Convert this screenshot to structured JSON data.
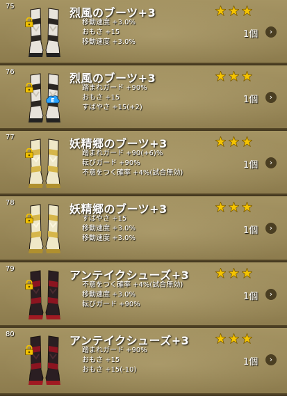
{
  "items": [
    {
      "number": "75",
      "name": "烈風のブーツ+3",
      "stats": [
        "移動速度 +3.0%",
        "おもさ +15",
        "移動速度 +3.0%"
      ],
      "quantity": "1個",
      "boot_style": "white-black",
      "equipped": false
    },
    {
      "number": "76",
      "name": "烈風のブーツ+3",
      "stats": [
        "踏まれガード +90%",
        "おもさ +15",
        "すばやさ +15(+2)"
      ],
      "quantity": "1個",
      "boot_style": "white-black",
      "equipped": true,
      "equipped_label": "E"
    },
    {
      "number": "77",
      "name": "妖精郷のブーツ+3",
      "stats": [
        "踏まれガード +90(+6)%",
        "転びガード +90%",
        "不意をつく確率 +4%(試合無効)"
      ],
      "quantity": "1個",
      "boot_style": "cream-gold",
      "equipped": false
    },
    {
      "number": "78",
      "name": "妖精郷のブーツ+3",
      "stats": [
        "すばやさ +15",
        "移動速度 +3.0%",
        "移動速度 +3.0%"
      ],
      "quantity": "1個",
      "boot_style": "cream-gold",
      "equipped": false
    },
    {
      "number": "79",
      "name": "アンテイクシューズ+3",
      "stats": [
        "不意をつく確率 +4%(試合無効)",
        "移動速度 +3.0%",
        "転びガード +90%"
      ],
      "quantity": "1個",
      "boot_style": "black-red",
      "equipped": false
    },
    {
      "number": "80",
      "name": "アンテイクシューズ+3",
      "stats": [
        "踏まれガード +90%",
        "おもさ +15",
        "おもさ +15(-10)"
      ],
      "quantity": "1個",
      "boot_style": "black-red",
      "equipped": false
    }
  ],
  "rating": 3,
  "icons": {
    "lock": "lock-icon",
    "star": "star-icon",
    "chevron": "chevron-right-icon",
    "equip": "equipped-badge-icon"
  },
  "chevron_glyph": "›",
  "colors": {
    "star": "#f5c400",
    "lock": "#f2c200",
    "equip": "#2aa3ff"
  }
}
